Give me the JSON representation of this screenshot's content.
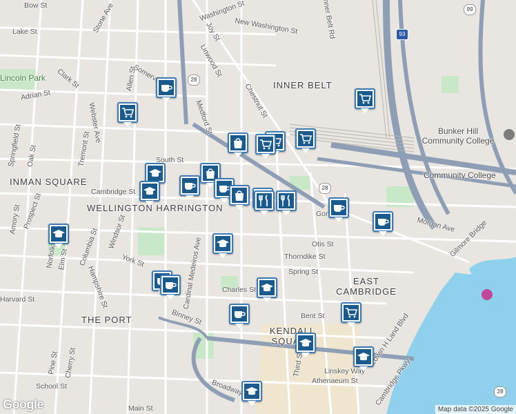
{
  "areas": [
    {
      "label": "INNER BELT"
    },
    {
      "label": "INMAN SQUARE"
    },
    {
      "label": "WELLINGTON HARRINGTON"
    },
    {
      "label": "THE PORT"
    },
    {
      "label": "EAST CAMBRIDGE"
    },
    {
      "label": "KENDALL SQUARE"
    }
  ],
  "pois": [
    {
      "label": "Lincoln Park"
    },
    {
      "label": "Bunker Hill Community College"
    },
    {
      "label": "Community College"
    }
  ],
  "streets": [
    "Bow St",
    "Stone Ave",
    "Washington St",
    "New Washington St",
    "Inner Belt Rd",
    "Lake St",
    "Joy St",
    "Linwood St",
    "Somerville Ave",
    "Allen St",
    "Clark St",
    "Adrian St",
    "Medford St",
    "Chestnut St",
    "Webster Ave",
    "Tremont St",
    "Springfield St",
    "Oak St",
    "South St",
    "Cambridge St",
    "Amory St",
    "Prospect St",
    "Columbia St",
    "Windsor St",
    "Norfolk St",
    "Elm St",
    "York St",
    "Hampshire St",
    "Harvard St",
    "Binney St",
    "Charles St",
    "Thorndike St",
    "Spring St",
    "Otis St",
    "Gore St",
    "Morgan Ave",
    "Gilmore Bridge",
    "Bent St",
    "Third St",
    "Linskey Way",
    "Athenaeum St",
    "Edwin H Land Blvd",
    "Cambridge Pkwy",
    "Broadway",
    "Main St",
    "School St",
    "Pine St",
    "Cherry St",
    "Cardinal Medeiros Ave"
  ],
  "route_shields": [
    "99",
    "93",
    "28",
    "28",
    "28"
  ],
  "icons": {
    "coffee": "coffee-icon",
    "cart": "shopping-cart-icon",
    "school": "graduation-cap-icon",
    "bag": "shopping-bag-icon",
    "food": "fork-knife-icon"
  },
  "colors": {
    "land": "#e9e5e1",
    "water": "#8fd1ec",
    "park": "#c9e8c7",
    "highway": "#8e9fb5",
    "marker_fill": "#1a5a8c",
    "marker_border": "#3b7ab5"
  },
  "markers": [
    {
      "type": "coffee"
    },
    {
      "type": "cart"
    },
    {
      "type": "cart"
    },
    {
      "type": "cart"
    },
    {
      "type": "cart"
    },
    {
      "type": "bag"
    },
    {
      "type": "cart"
    },
    {
      "type": "school"
    },
    {
      "type": "school"
    },
    {
      "type": "coffee"
    },
    {
      "type": "bag"
    },
    {
      "type": "coffee"
    },
    {
      "type": "bag"
    },
    {
      "type": "food"
    },
    {
      "type": "food"
    },
    {
      "type": "food"
    },
    {
      "type": "coffee"
    },
    {
      "type": "coffee"
    },
    {
      "type": "school"
    },
    {
      "type": "school"
    },
    {
      "type": "coffee"
    },
    {
      "type": "coffee"
    },
    {
      "type": "school"
    },
    {
      "type": "coffee"
    },
    {
      "type": "cart"
    },
    {
      "type": "school"
    },
    {
      "type": "school"
    },
    {
      "type": "school"
    }
  ],
  "footer": {
    "logo": "Google",
    "attribution": "Map data ©2025 Google"
  }
}
